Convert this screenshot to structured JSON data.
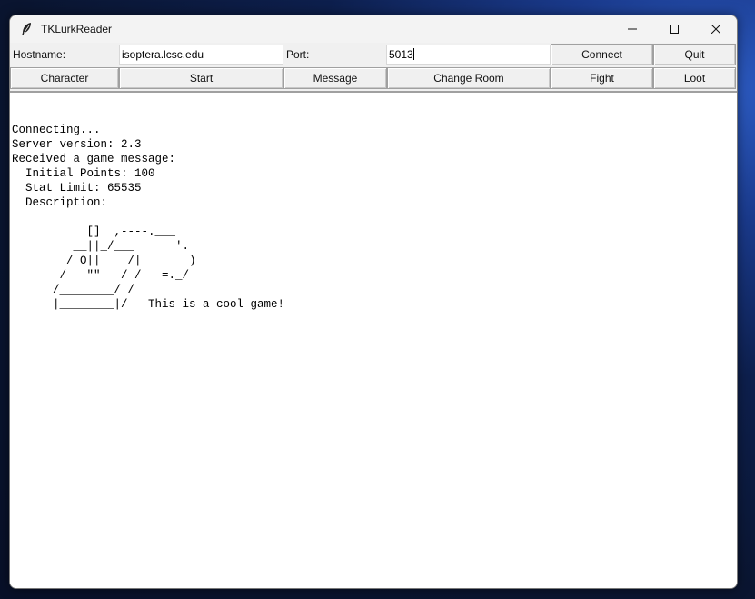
{
  "window": {
    "title": "TKLurkReader",
    "controls": {
      "minimize": "minimize-icon",
      "maximize": "maximize-icon",
      "close": "close-icon"
    }
  },
  "connection": {
    "hostname_label": "Hostname:",
    "hostname_value": "isoptera.lcsc.edu",
    "port_label": "Port:",
    "port_value": "5013",
    "connect_label": "Connect",
    "quit_label": "Quit"
  },
  "actions": {
    "character_label": "Character",
    "start_label": "Start",
    "message_label": "Message",
    "change_room_label": "Change Room",
    "fight_label": "Fight",
    "loot_label": "Loot"
  },
  "output": {
    "text": "Connecting...\nServer version: 2.3\nReceived a game message:\n  Initial Points: 100\n  Stat Limit: 65535\n  Description:\n\n           []  ,----.___\n         __||_/___      '.\n        / O||    /|       )\n       /   \"\"   / /   =._/\n      /________/ /\n      |________|/   This is a cool game!"
  }
}
